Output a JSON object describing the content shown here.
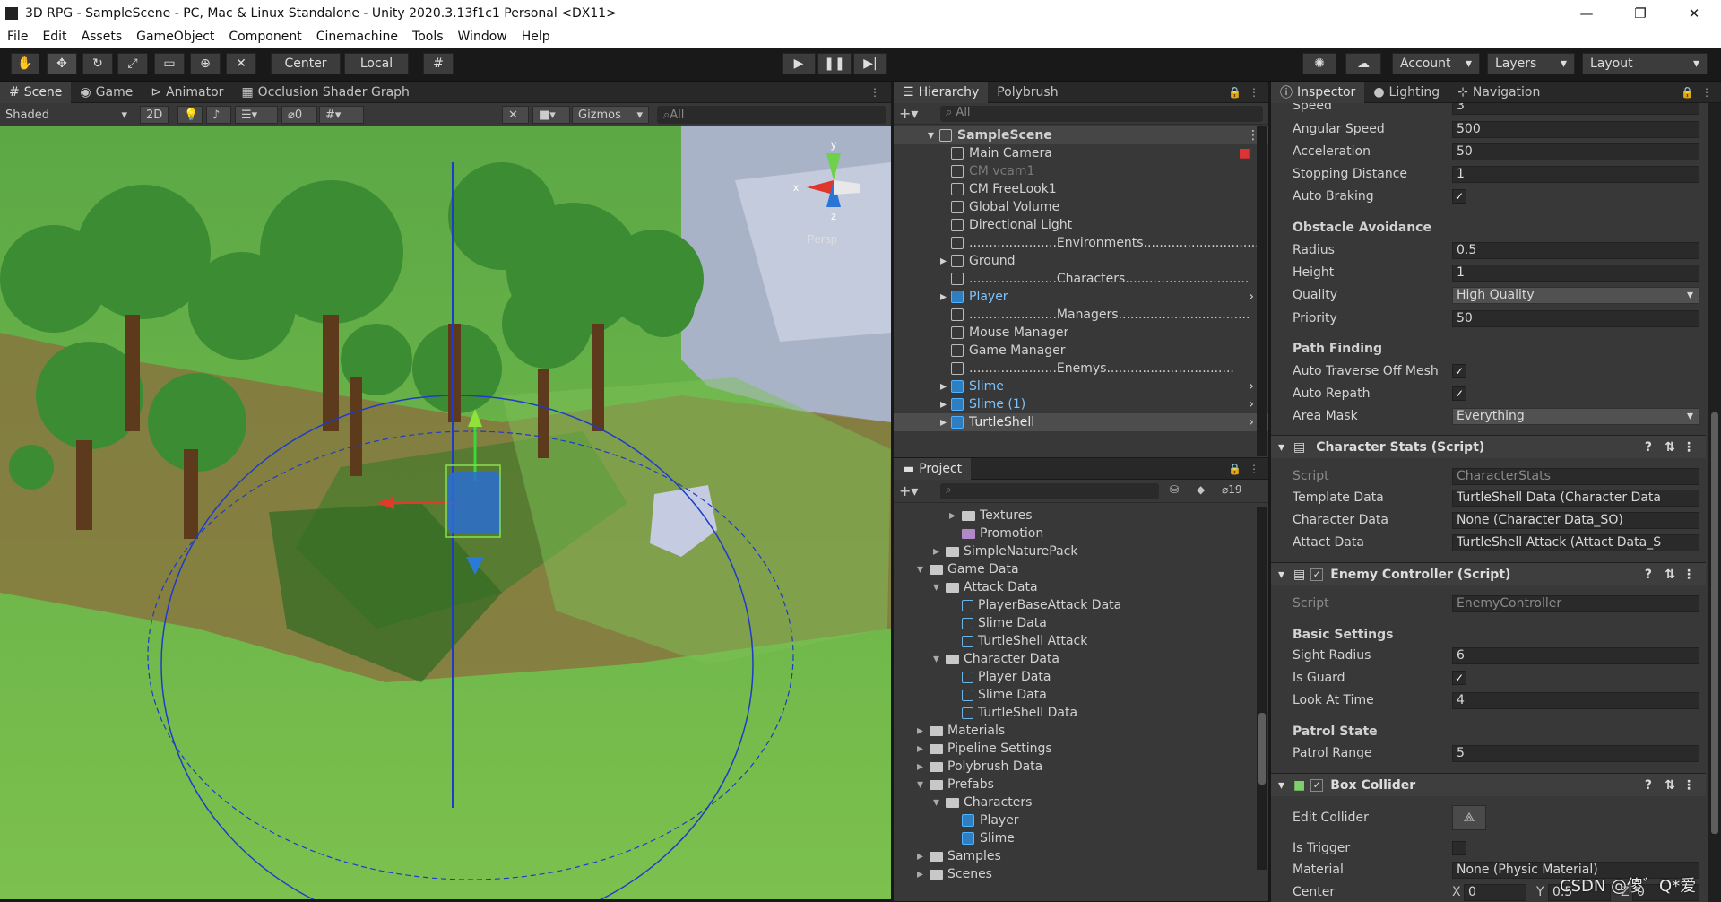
{
  "window": {
    "title": "3D RPG - SampleScene - PC, Mac & Linux Standalone - Unity 2020.3.13f1c1 Personal <DX11>",
    "min": "—",
    "max": "❐",
    "close": "✕"
  },
  "menu": [
    "File",
    "Edit",
    "Assets",
    "GameObject",
    "Component",
    "Cinemachine",
    "Tools",
    "Window",
    "Help"
  ],
  "toolbar": {
    "center": "Center",
    "local": "Local",
    "account": "Account",
    "layers": "Layers",
    "layout": "Layout"
  },
  "scene_tabs": [
    "Scene",
    "Game",
    "Animator",
    "Occlusion Shader Graph"
  ],
  "scene_bar": {
    "shading": "Shaded",
    "mode2d": "2D",
    "hidden_count": "0",
    "gizmos": "Gizmos",
    "search_placeholder": "All",
    "persp": "Persp",
    "gizmo_axes": {
      "x": "x",
      "y": "y",
      "z": "z"
    }
  },
  "hierarchy": {
    "tabs": [
      "Hierarchy",
      "Polybrush"
    ],
    "search_placeholder": "All",
    "scene": "SampleScene",
    "items": [
      {
        "name": "Main Camera",
        "indent": 1,
        "type": "go"
      },
      {
        "name": "CM vcam1",
        "indent": 1,
        "type": "disabled"
      },
      {
        "name": "CM FreeLook1",
        "indent": 1,
        "type": "go"
      },
      {
        "name": "Global Volume",
        "indent": 1,
        "type": "go"
      },
      {
        "name": "Directional Light",
        "indent": 1,
        "type": "go"
      },
      {
        "name": "......................Environments..........................................",
        "indent": 1,
        "type": "go"
      },
      {
        "name": "Ground",
        "indent": 1,
        "type": "go",
        "arrow": true
      },
      {
        "name": "......................Characters...............................",
        "indent": 1,
        "type": "go"
      },
      {
        "name": "Player",
        "indent": 1,
        "type": "prefab",
        "arrow": true
      },
      {
        "name": "......................Managers.................................",
        "indent": 1,
        "type": "go"
      },
      {
        "name": "Mouse Manager",
        "indent": 1,
        "type": "go"
      },
      {
        "name": "Game Manager",
        "indent": 1,
        "type": "go"
      },
      {
        "name": "......................Enemys................................",
        "indent": 1,
        "type": "go"
      },
      {
        "name": "Slime",
        "indent": 1,
        "type": "prefab",
        "arrow": true
      },
      {
        "name": "Slime (1)",
        "indent": 1,
        "type": "prefab",
        "arrow": true
      },
      {
        "name": "TurtleShell",
        "indent": 1,
        "type": "prefab-sel",
        "arrow": true
      }
    ]
  },
  "project": {
    "tab": "Project",
    "hidden_count": "19",
    "items": [
      {
        "name": "Textures",
        "indent": 3,
        "kind": "folder",
        "arrow": "right"
      },
      {
        "name": "Promotion",
        "indent": 3,
        "kind": "asset"
      },
      {
        "name": "SimpleNaturePack",
        "indent": 2,
        "kind": "folder",
        "arrow": "right"
      },
      {
        "name": "Game Data",
        "indent": 1,
        "kind": "folder",
        "arrow": "down"
      },
      {
        "name": "Attack Data",
        "indent": 2,
        "kind": "folder",
        "arrow": "down"
      },
      {
        "name": "PlayerBaseAttack Data",
        "indent": 3,
        "kind": "so"
      },
      {
        "name": "Slime Data",
        "indent": 3,
        "kind": "so"
      },
      {
        "name": "TurtleShell Attack",
        "indent": 3,
        "kind": "so"
      },
      {
        "name": "Character Data",
        "indent": 2,
        "kind": "folder",
        "arrow": "down"
      },
      {
        "name": "Player Data",
        "indent": 3,
        "kind": "so"
      },
      {
        "name": "Slime Data",
        "indent": 3,
        "kind": "so"
      },
      {
        "name": "TurtleShell Data",
        "indent": 3,
        "kind": "so"
      },
      {
        "name": "Materials",
        "indent": 1,
        "kind": "folder",
        "arrow": "right"
      },
      {
        "name": "Pipeline Settings",
        "indent": 1,
        "kind": "folder",
        "arrow": "right"
      },
      {
        "name": "Polybrush Data",
        "indent": 1,
        "kind": "folder",
        "arrow": "right"
      },
      {
        "name": "Prefabs",
        "indent": 1,
        "kind": "folder",
        "arrow": "down"
      },
      {
        "name": "Characters",
        "indent": 2,
        "kind": "folder",
        "arrow": "down"
      },
      {
        "name": "Player",
        "indent": 3,
        "kind": "prefab"
      },
      {
        "name": "Slime",
        "indent": 3,
        "kind": "prefab"
      },
      {
        "name": "Samples",
        "indent": 1,
        "kind": "folder",
        "arrow": "right"
      },
      {
        "name": "Scenes",
        "indent": 1,
        "kind": "folder",
        "arrow": "right"
      }
    ]
  },
  "inspector": {
    "tabs": [
      "Inspector",
      "Lighting",
      "Navigation"
    ],
    "nav": {
      "speed_label": "Speed",
      "speed": "3",
      "angular_label": "Angular Speed",
      "angular": "500",
      "accel_label": "Acceleration",
      "accel": "50",
      "stop_label": "Stopping Distance",
      "stop": "1",
      "braking_label": "Auto Braking",
      "obstacle": "Obstacle Avoidance",
      "radius_label": "Radius",
      "radius": "0.5",
      "height_label": "Height",
      "height": "1",
      "quality_label": "Quality",
      "quality": "High Quality",
      "priority_label": "Priority",
      "priority": "50",
      "path": "Path Finding",
      "traverse_label": "Auto Traverse Off Mesh",
      "repath_label": "Auto Repath",
      "area_label": "Area Mask",
      "area": "Everything"
    },
    "stats": {
      "title": "Character Stats (Script)",
      "script_label": "Script",
      "script": "CharacterStats",
      "template_label": "Template Data",
      "template": "TurtleShell Data (Character Data",
      "char_label": "Character Data",
      "char": "None (Character Data_SO)",
      "attack_label": "Attact Data",
      "attack": "TurtleShell Attack (Attact Data_S"
    },
    "enemy": {
      "title": "Enemy Controller (Script)",
      "script_label": "Script",
      "script": "EnemyController",
      "basic": "Basic Settings",
      "sight_label": "Sight Radius",
      "sight": "6",
      "guard_label": "Is Guard",
      "look_label": "Look At Time",
      "look": "4",
      "patrol": "Patrol State",
      "range_label": "Patrol Range",
      "range": "5"
    },
    "box": {
      "title": "Box Collider",
      "edit_label": "Edit Collider",
      "trigger_label": "Is Trigger",
      "material_label": "Material",
      "material": "None (Physic Material)",
      "center_label": "Center",
      "cx": "0",
      "cy": "0.5",
      "cz": "0",
      "x": "X",
      "y": "Y",
      "z": "Z"
    }
  },
  "watermark": "CSDN @傻゛Q*爱"
}
